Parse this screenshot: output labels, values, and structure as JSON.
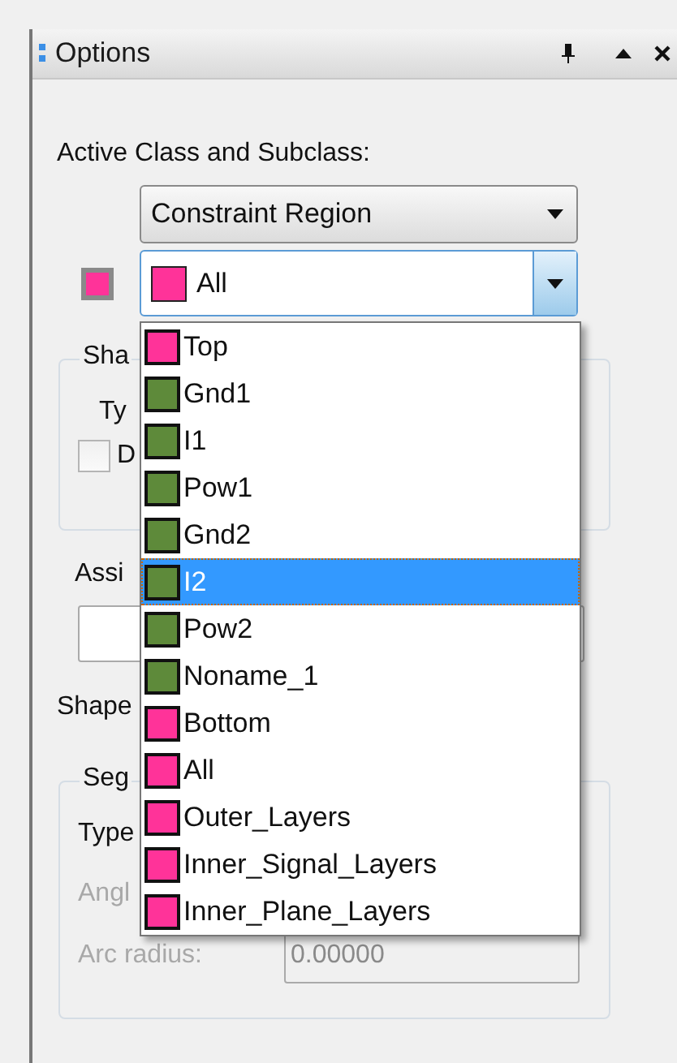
{
  "panel": {
    "title": "Options"
  },
  "active_class": {
    "label": "Active Class and Subclass:",
    "class_value": "Constraint Region",
    "subclass": {
      "value": "All",
      "color": "#ff3399"
    }
  },
  "dropdown": {
    "items": [
      {
        "label": "Top",
        "color": "#ff3399",
        "selected": false
      },
      {
        "label": "Gnd1",
        "color": "#5e8a3a",
        "selected": false
      },
      {
        "label": "I1",
        "color": "#5e8a3a",
        "selected": false
      },
      {
        "label": "Pow1",
        "color": "#5e8a3a",
        "selected": false
      },
      {
        "label": "Gnd2",
        "color": "#5e8a3a",
        "selected": false
      },
      {
        "label": "I2",
        "color": "#5e8a3a",
        "selected": true
      },
      {
        "label": "Pow2",
        "color": "#5e8a3a",
        "selected": false
      },
      {
        "label": "Noname_1",
        "color": "#5e8a3a",
        "selected": false
      },
      {
        "label": "Bottom",
        "color": "#ff3399",
        "selected": false
      },
      {
        "label": "All",
        "color": "#ff3399",
        "selected": false
      },
      {
        "label": "Outer_Layers",
        "color": "#ff3399",
        "selected": false
      },
      {
        "label": "Inner_Signal_Layers",
        "color": "#ff3399",
        "selected": false
      },
      {
        "label": "Inner_Plane_Layers",
        "color": "#ff3399",
        "selected": false
      }
    ]
  },
  "shape_group": {
    "legend": "Sha",
    "type_label": "Ty",
    "checkbox": {
      "label": "D",
      "checked": false
    }
  },
  "assign": {
    "label": "Assi"
  },
  "shape_label": "Shape",
  "segment_group": {
    "legend": "Seg",
    "type_label": "Type",
    "angle_label": {
      "text": "Angl",
      "disabled": true
    },
    "arc_radius": {
      "label": "Arc radius:",
      "value": "0.00000",
      "disabled": true
    }
  }
}
